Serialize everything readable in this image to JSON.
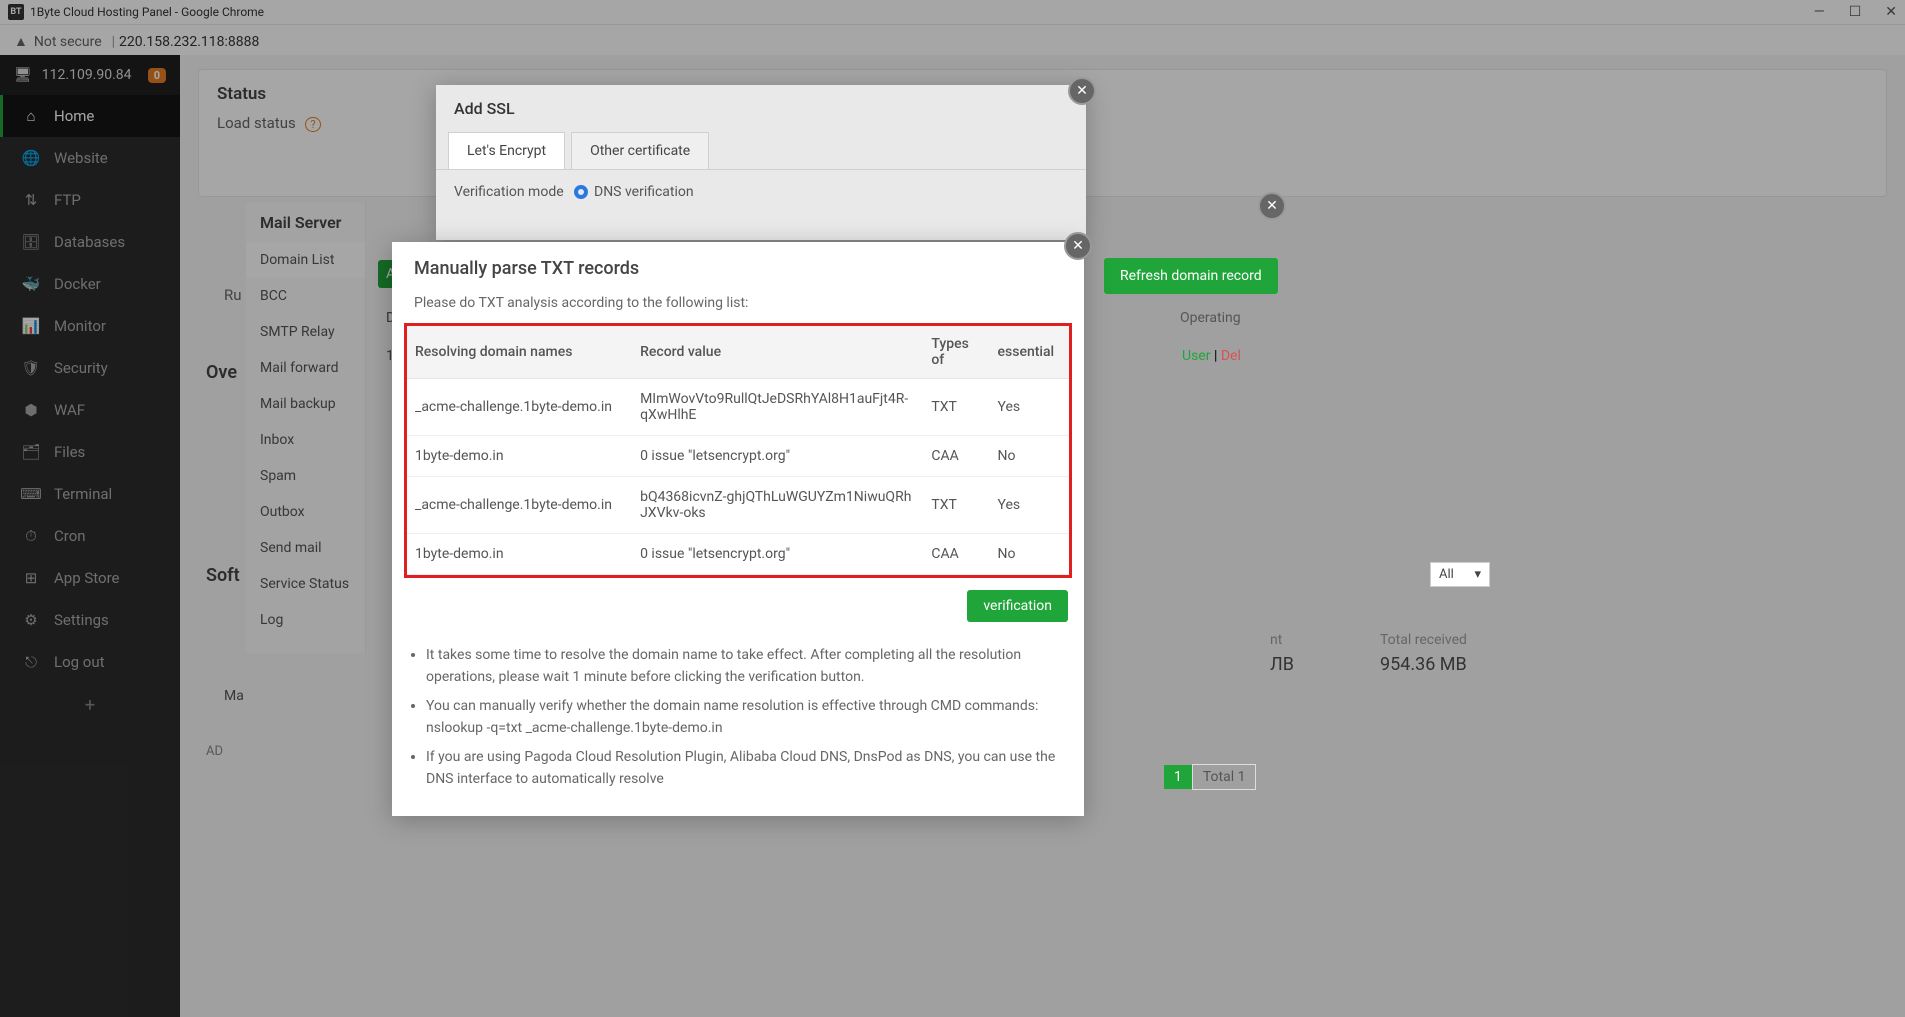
{
  "browser": {
    "title": "1Byte Cloud Hosting Panel - Google Chrome",
    "icon_label": "BT",
    "not_secure": "Not secure",
    "url": "220.158.232.118:8888"
  },
  "sidebar": {
    "ip": "112.109.90.84",
    "badge": "0",
    "items": [
      {
        "icon": "home-icon",
        "label": "Home"
      },
      {
        "icon": "globe-icon",
        "label": "Website"
      },
      {
        "icon": "ftp-icon",
        "label": "FTP"
      },
      {
        "icon": "database-icon",
        "label": "Databases"
      },
      {
        "icon": "docker-icon",
        "label": "Docker"
      },
      {
        "icon": "monitor-icon",
        "label": "Monitor"
      },
      {
        "icon": "shield-icon",
        "label": "Security"
      },
      {
        "icon": "waf-icon",
        "label": "WAF"
      },
      {
        "icon": "folder-icon",
        "label": "Files"
      },
      {
        "icon": "terminal-icon",
        "label": "Terminal"
      },
      {
        "icon": "cron-icon",
        "label": "Cron"
      },
      {
        "icon": "appstore-icon",
        "label": "App Store"
      },
      {
        "icon": "gear-icon",
        "label": "Settings"
      },
      {
        "icon": "logout-icon",
        "label": "Log out"
      }
    ]
  },
  "background": {
    "status": "Status",
    "load_status": "Load status",
    "run_prefix": "Ru",
    "overview": "Ove",
    "software": "Soft",
    "mail_label": "Ma",
    "ad_label": "AD",
    "d_label": "D",
    "one_label": "1",
    "add_btn": "A"
  },
  "mail_panel": {
    "title": "Mail Server",
    "items": [
      "Domain List",
      "BCC",
      "SMTP Relay",
      "Mail forward",
      "Mail backup",
      "Inbox",
      "Spam",
      "Outbox",
      "Send mail",
      "Service Status",
      "Log"
    ]
  },
  "right_bg": {
    "refresh": "Refresh domain record",
    "operating": "Operating",
    "user": "User",
    "sep": " | ",
    "del": "Del",
    "all": "All",
    "nt": "nt",
    "mb": "ЛB",
    "total_received": "Total received",
    "total_received_val": "954.36 MB",
    "page1": "1",
    "total1": "Total 1"
  },
  "modal_ssl": {
    "title": "Add SSL",
    "tabs": {
      "le": "Let's Encrypt",
      "other": "Other certificate"
    },
    "verification_mode": "Verification mode",
    "dns_verification": "DNS verification"
  },
  "modal_txt": {
    "title": "Manually parse TXT records",
    "subtitle": "Please do TXT analysis according to the following list:",
    "columns": [
      "Resolving domain names",
      "Record value",
      "Types of",
      "essential"
    ],
    "rows": [
      {
        "domain": "_acme-challenge.1byte-demo.in",
        "value": "MImWovVto9RullQtJeDSRhYAl8H1auFjt4R-qXwHlhE",
        "type": "TXT",
        "essential": "Yes"
      },
      {
        "domain": "1byte-demo.in",
        "value": "0 issue \"letsencrypt.org\"",
        "type": "CAA",
        "essential": "No"
      },
      {
        "domain": "_acme-challenge.1byte-demo.in",
        "value": "bQ4368icvnZ-ghjQThLuWGUYZm1NiwuQRhJXVkv-oks",
        "type": "TXT",
        "essential": "Yes"
      },
      {
        "domain": "1byte-demo.in",
        "value": "0 issue \"letsencrypt.org\"",
        "type": "CAA",
        "essential": "No"
      }
    ],
    "verify_btn": "verification",
    "notes": [
      "It takes some time to resolve the domain name to take effect. After completing all the resolution operations, please wait 1 minute before clicking the verification button.",
      "You can manually verify whether the domain name resolution is effective through CMD commands: nslookup -q=txt _acme-challenge.1byte-demo.in",
      "If you are using Pagoda Cloud Resolution Plugin, Alibaba Cloud DNS, DnsPod as DNS, you can use the DNS interface to automatically resolve"
    ]
  }
}
